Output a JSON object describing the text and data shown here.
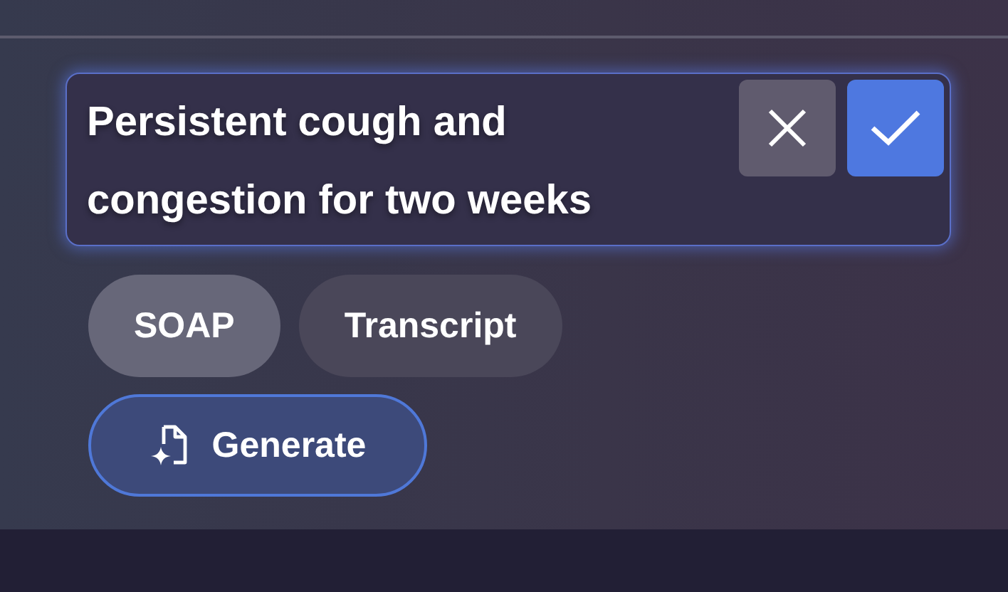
{
  "editor": {
    "value": "Persistent cough and congestion for two weeks"
  },
  "formats": [
    {
      "label": "SOAP",
      "selected": true
    },
    {
      "label": "Transcript",
      "selected": false
    }
  ],
  "generate_button": {
    "label": "Generate"
  }
}
